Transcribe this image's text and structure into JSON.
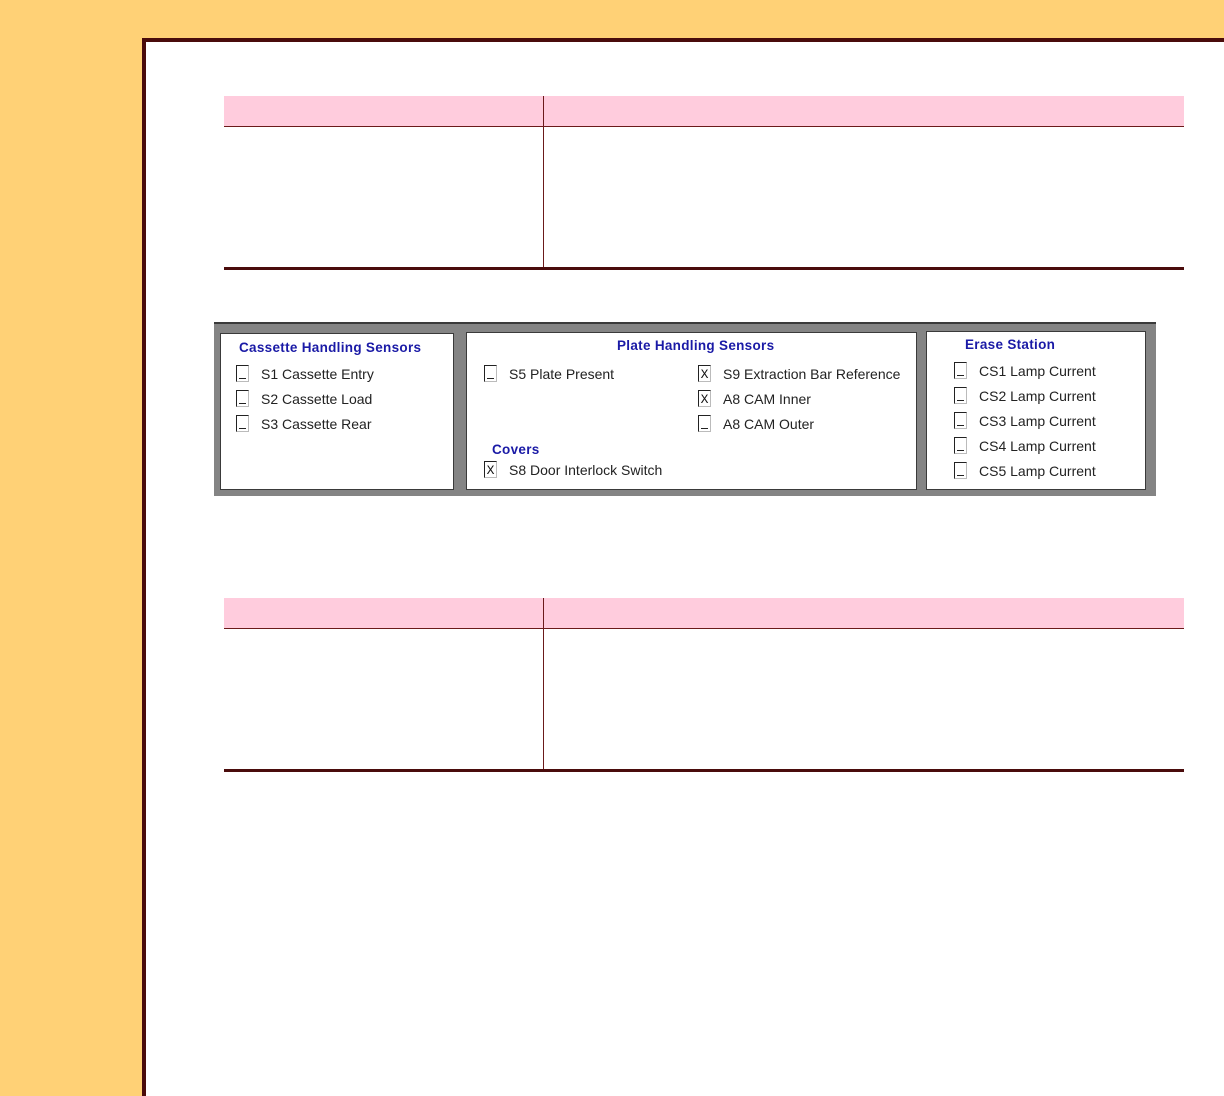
{
  "panel": {
    "cassette": {
      "title": "Cassette Handling Sensors",
      "items": [
        {
          "label": "S1 Cassette Entry",
          "mark": ""
        },
        {
          "label": "S2 Cassette Load",
          "mark": ""
        },
        {
          "label": "S3 Cassette Rear",
          "mark": ""
        }
      ]
    },
    "plate": {
      "title": "Plate Handling Sensors",
      "items": [
        {
          "label": "S5 Plate Present",
          "mark": ""
        },
        {
          "label": "S9 Extraction Bar Reference",
          "mark": "X"
        },
        {
          "label": "A8 CAM Inner",
          "mark": "X"
        },
        {
          "label": "A8 CAM Outer",
          "mark": ""
        }
      ],
      "covers_title": "Covers",
      "covers_items": [
        {
          "label": "S8 Door Interlock Switch",
          "mark": "X"
        }
      ]
    },
    "erase": {
      "title": "Erase Station",
      "items": [
        {
          "label": "CS1 Lamp Current",
          "mark": ""
        },
        {
          "label": "CS2 Lamp Current",
          "mark": ""
        },
        {
          "label": "CS3 Lamp Current",
          "mark": ""
        },
        {
          "label": "CS4 Lamp Current",
          "mark": ""
        },
        {
          "label": "CS5 Lamp Current",
          "mark": ""
        }
      ]
    }
  }
}
